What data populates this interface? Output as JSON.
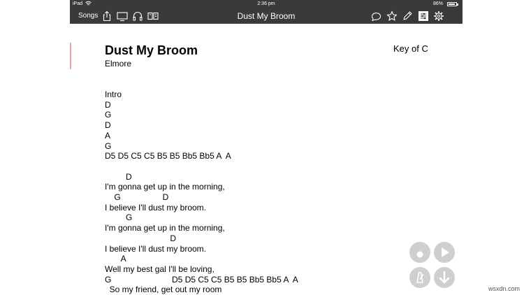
{
  "status_bar": {
    "carrier": "iPad",
    "time": "2:36 pm",
    "battery": "86%"
  },
  "toolbar": {
    "songs_label": "Songs",
    "title": "Dust My Broom",
    "left_icons": [
      "share-icon",
      "display-icon",
      "headphones-icon",
      "book-icon"
    ],
    "right_icons": [
      "comment-icon",
      "star-icon",
      "pencil-icon",
      "settings-panel-icon",
      "gear-icon"
    ]
  },
  "song": {
    "title": "Dust My Broom",
    "artist": "Elmore",
    "key": "Key of C",
    "lyrics": "Intro\nD\nG\nD\nA\nG\nD5 D5 C5 C5 B5 B5 Bb5 Bb5 A  A\n\n         D\nI'm gonna get up in the morning,\n    G                  D\nI believe I'll dust my broom.\n         G\nI'm gonna get up in the morning,\n                            D\nI believe I'll dust my broom.\n       A\nWell my best gal I'll be loving,\nG                          D5 D5 C5 C5 B5 B5 Bb5 Bb5 A  A\n  So my friend, get out my room"
  },
  "controls": [
    "metronome-dot-icon",
    "play-icon",
    "metronome-icon",
    "scroll-down-icon"
  ],
  "watermark": "wsxdn.com",
  "colors": {
    "toolbar_bg": "#3a3a3a",
    "margin_marker": "#e8a0a0",
    "control_bg": "#cfcfcf"
  }
}
